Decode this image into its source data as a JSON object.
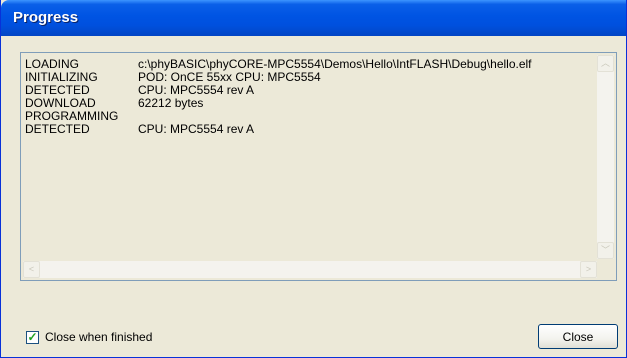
{
  "window": {
    "title": "Progress"
  },
  "log": {
    "rows": [
      {
        "key": "LOADING",
        "value": "c:\\phyBASIC\\phyCORE-MPC5554\\Demos\\Hello\\IntFLASH\\Debug\\hello.elf"
      },
      {
        "key": "INITIALIZING",
        "value": "POD: OnCE 55xx   CPU: MPC5554"
      },
      {
        "key": "DETECTED",
        "value": "CPU: MPC5554 rev A"
      },
      {
        "key": "DOWNLOAD",
        "value": "62212 bytes"
      },
      {
        "key": "PROGRAMMING",
        "value": ""
      },
      {
        "key": "DETECTED",
        "value": "CPU: MPC5554 rev A"
      }
    ]
  },
  "scrollbar": {
    "up_glyph": "︿",
    "down_glyph": "﹀",
    "left_glyph": "<",
    "right_glyph": ">"
  },
  "checkbox": {
    "label": "Close when finished",
    "checked": true,
    "check_glyph": "✓"
  },
  "close_button": {
    "label": "Close"
  },
  "colors": {
    "titlebar": "#0054e3",
    "window_bg": "#ece9d8",
    "log_border": "#7f9db9"
  }
}
